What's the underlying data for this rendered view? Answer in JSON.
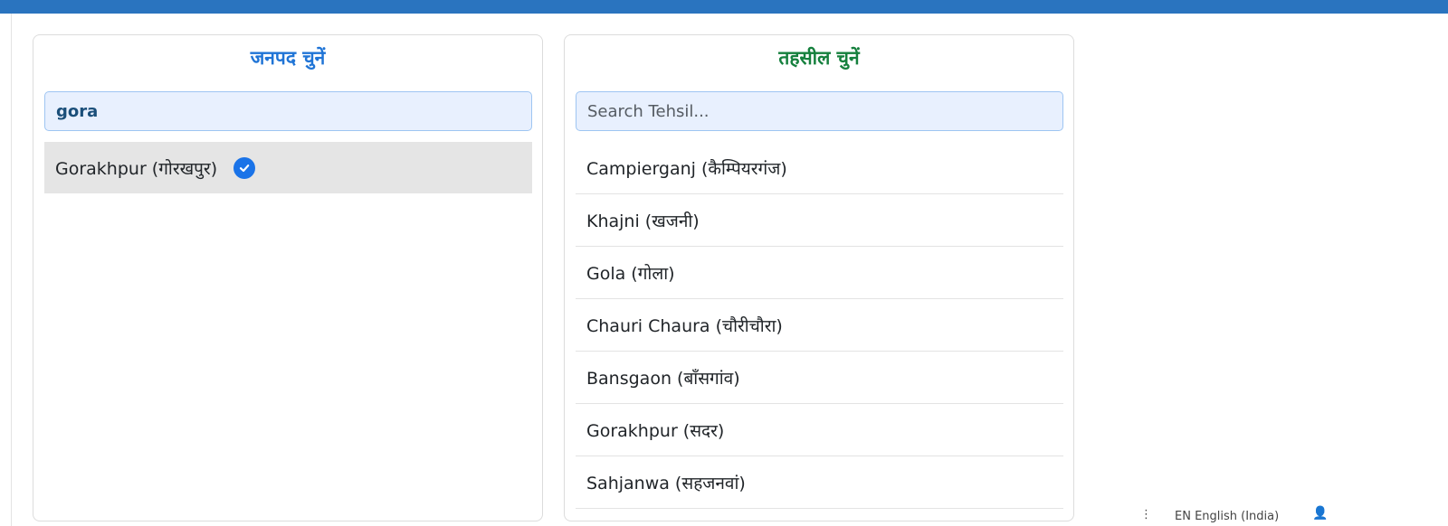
{
  "district_panel": {
    "title": "जनपद चुनें",
    "search_value": "gora",
    "selected_item": "Gorakhpur (गोरखपुर)"
  },
  "tehsil_panel": {
    "title": "तहसील चुनें",
    "search_placeholder": "Search Tehsil...",
    "items": [
      "Campierganj (कैम्पियरगंज)",
      "Khajni (खजनी)",
      "Gola (गोला)",
      "Chauri Chaura (चौरीचौरा)",
      "Bansgaon (बाँसगांव)",
      "Gorakhpur (सदर)",
      "Sahjanwa (सहजनवां)"
    ]
  },
  "footer": {
    "language": "EN English (India)"
  },
  "colors": {
    "top_bar": "#2a74bf",
    "district_title": "#1f74d6",
    "tehsil_title": "#15803d",
    "check": "#1a73e8"
  }
}
